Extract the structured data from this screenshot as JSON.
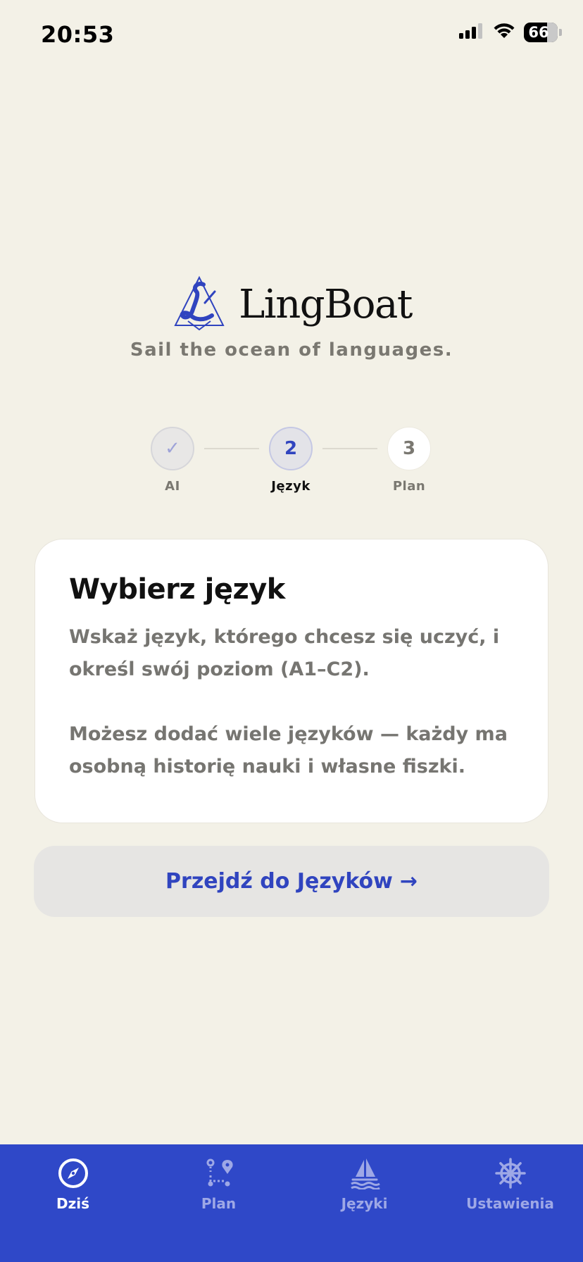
{
  "status_bar": {
    "time": "20:53",
    "battery": "66"
  },
  "app": {
    "name": "LingBoat",
    "tagline": "Sail the ocean of languages."
  },
  "stepper": {
    "steps": [
      {
        "label": "AI",
        "marker": "✓",
        "state": "done"
      },
      {
        "label": "Język",
        "marker": "2",
        "state": "active"
      },
      {
        "label": "Plan",
        "marker": "3",
        "state": "todo"
      }
    ]
  },
  "card": {
    "title": "Wybierz język",
    "paragraph1": "Wskaż język, którego chcesz się uczyć, i określ swój poziom (A1–C2).",
    "paragraph2": "Możesz dodać wiele języków — każdy ma osobną historię nauki i własne fiszki."
  },
  "cta": {
    "label": "Przejdź do Języków",
    "arrow": "→"
  },
  "tabbar": {
    "tabs": [
      {
        "label": "Dziś",
        "icon": "compass-icon",
        "active": true
      },
      {
        "label": "Plan",
        "icon": "route-icon",
        "active": false
      },
      {
        "label": "Języki",
        "icon": "sailboat-icon",
        "active": false
      },
      {
        "label": "Ustawienia",
        "icon": "ship-wheel-icon",
        "active": false
      }
    ]
  },
  "colors": {
    "background": "#F3F1E7",
    "accent": "#2F48C8",
    "accent_text": "#3044BF",
    "muted_text": "#767571",
    "card": "#FFFFFF"
  }
}
